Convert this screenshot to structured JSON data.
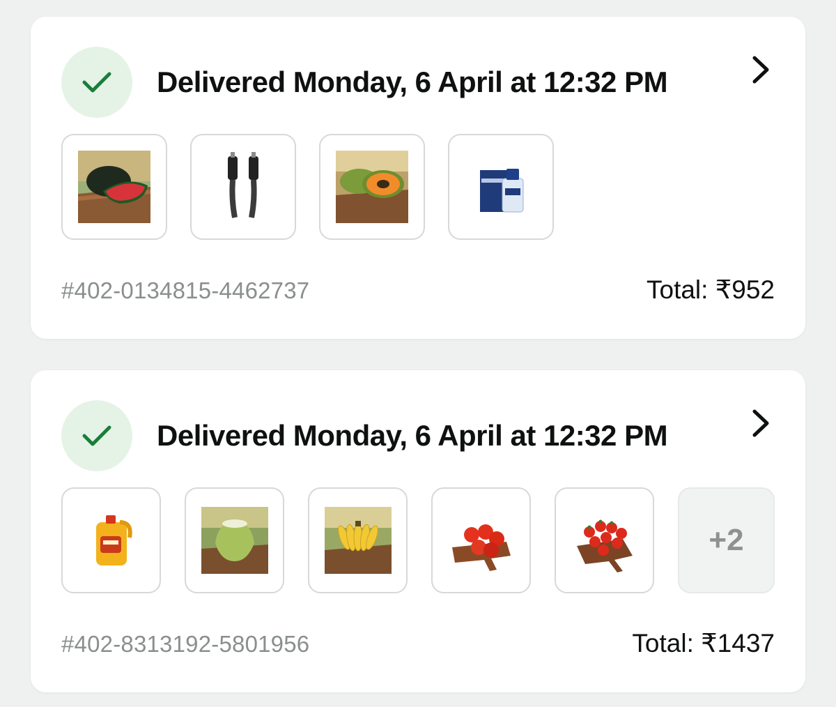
{
  "orders": [
    {
      "status": "Delivered Monday, 6 April at 12:32 PM",
      "items": [
        {
          "name": "Watermelon"
        },
        {
          "name": "USB-C cable"
        },
        {
          "name": "Papaya"
        },
        {
          "name": "Gillette after shave"
        }
      ],
      "order_id": "#402-0134815-4462737",
      "total": "Total: ₹952"
    },
    {
      "status": "Delivered Monday, 6 April at 12:32 PM",
      "items": [
        {
          "name": "Saffola cooking oil"
        },
        {
          "name": "Tender coconut"
        },
        {
          "name": "Bananas"
        },
        {
          "name": "Tomatoes"
        },
        {
          "name": "Cherry tomatoes"
        }
      ],
      "more_label": "+2",
      "order_id": "#402-8313192-5801956",
      "total": "Total: ₹1437"
    }
  ],
  "icons": {
    "status": "check-icon",
    "open": "chevron-right-icon"
  },
  "colors": {
    "check": "#1b7d3a",
    "status_bg": "#e5f3e7",
    "page_bg": "#eff1f1"
  }
}
